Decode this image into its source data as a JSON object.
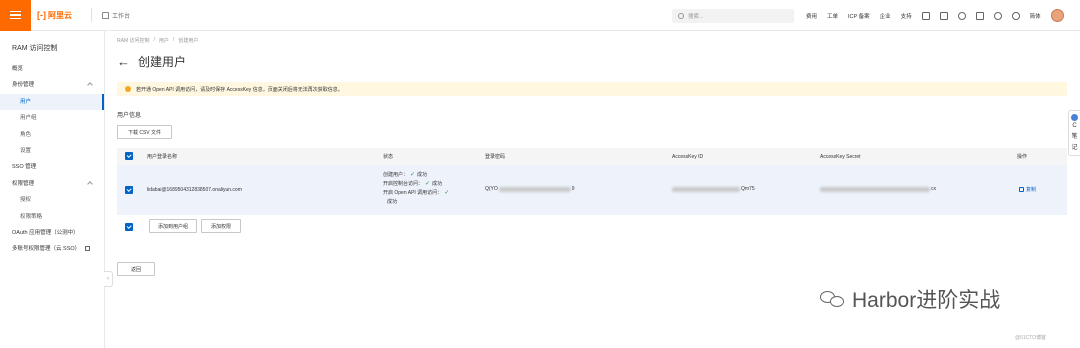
{
  "topbar": {
    "logo_mark": "[-]",
    "logo_text": "阿里云",
    "workbench": "工作台",
    "search_placeholder": "搜索...",
    "links": [
      "费用",
      "工单",
      "ICP 备案",
      "企业",
      "支持"
    ],
    "lang": "简体"
  },
  "sidebar": {
    "title": "RAM 访问控制",
    "items": [
      {
        "label": "概览"
      },
      {
        "label": "身份管理"
      },
      {
        "label": "用户"
      },
      {
        "label": "用户组"
      },
      {
        "label": "角色"
      },
      {
        "label": "设置"
      },
      {
        "label": "SSO 管理"
      },
      {
        "label": "权限管理"
      },
      {
        "label": "授权"
      },
      {
        "label": "权限策略"
      },
      {
        "label": "OAuth 应用管理（公测中）"
      },
      {
        "label": "多账号权限管理（云 SSO）"
      }
    ]
  },
  "breadcrumb": [
    "RAM 访问控制",
    "/",
    "用户",
    "/",
    "创建用户"
  ],
  "page": {
    "back": "←",
    "title": "创建用户",
    "alert": "若开通 Open API 调用访问，请及时保存 AccessKey 信息，页面关闭后将无法再次获取信息。",
    "section": "用户信息",
    "download_csv": "下载 CSV 文件"
  },
  "table": {
    "headers": [
      "用户登录名称",
      "状态",
      "登录密码",
      "AccessKey ID",
      "AccessKey Secret",
      "操作"
    ],
    "row": {
      "login": "lidabai@1689504312838507.onaliyun.com",
      "status": [
        "创建用户：",
        "成功",
        "开启控制台访问：",
        "成功",
        "开启 Open API 调用访问：",
        "成功"
      ],
      "password_prefix": "Q(YO",
      "password_suffix": "9",
      "akid_suffix": "Qm75",
      "secret_suffix": "cx",
      "action": "复制"
    }
  },
  "buttons": {
    "add_group": "添加到用户组",
    "add_permission": "添加权限",
    "return": "返回"
  },
  "right_float": [
    "C",
    "笔",
    "记"
  ],
  "watermark": {
    "main": "Harbor进阶实战",
    "small": "@51CTO博客"
  },
  "colors": {
    "brand": "#ff6a00",
    "link": "#0064c8",
    "alert_bg": "#fff7e0",
    "success": "#1e8e3e"
  }
}
